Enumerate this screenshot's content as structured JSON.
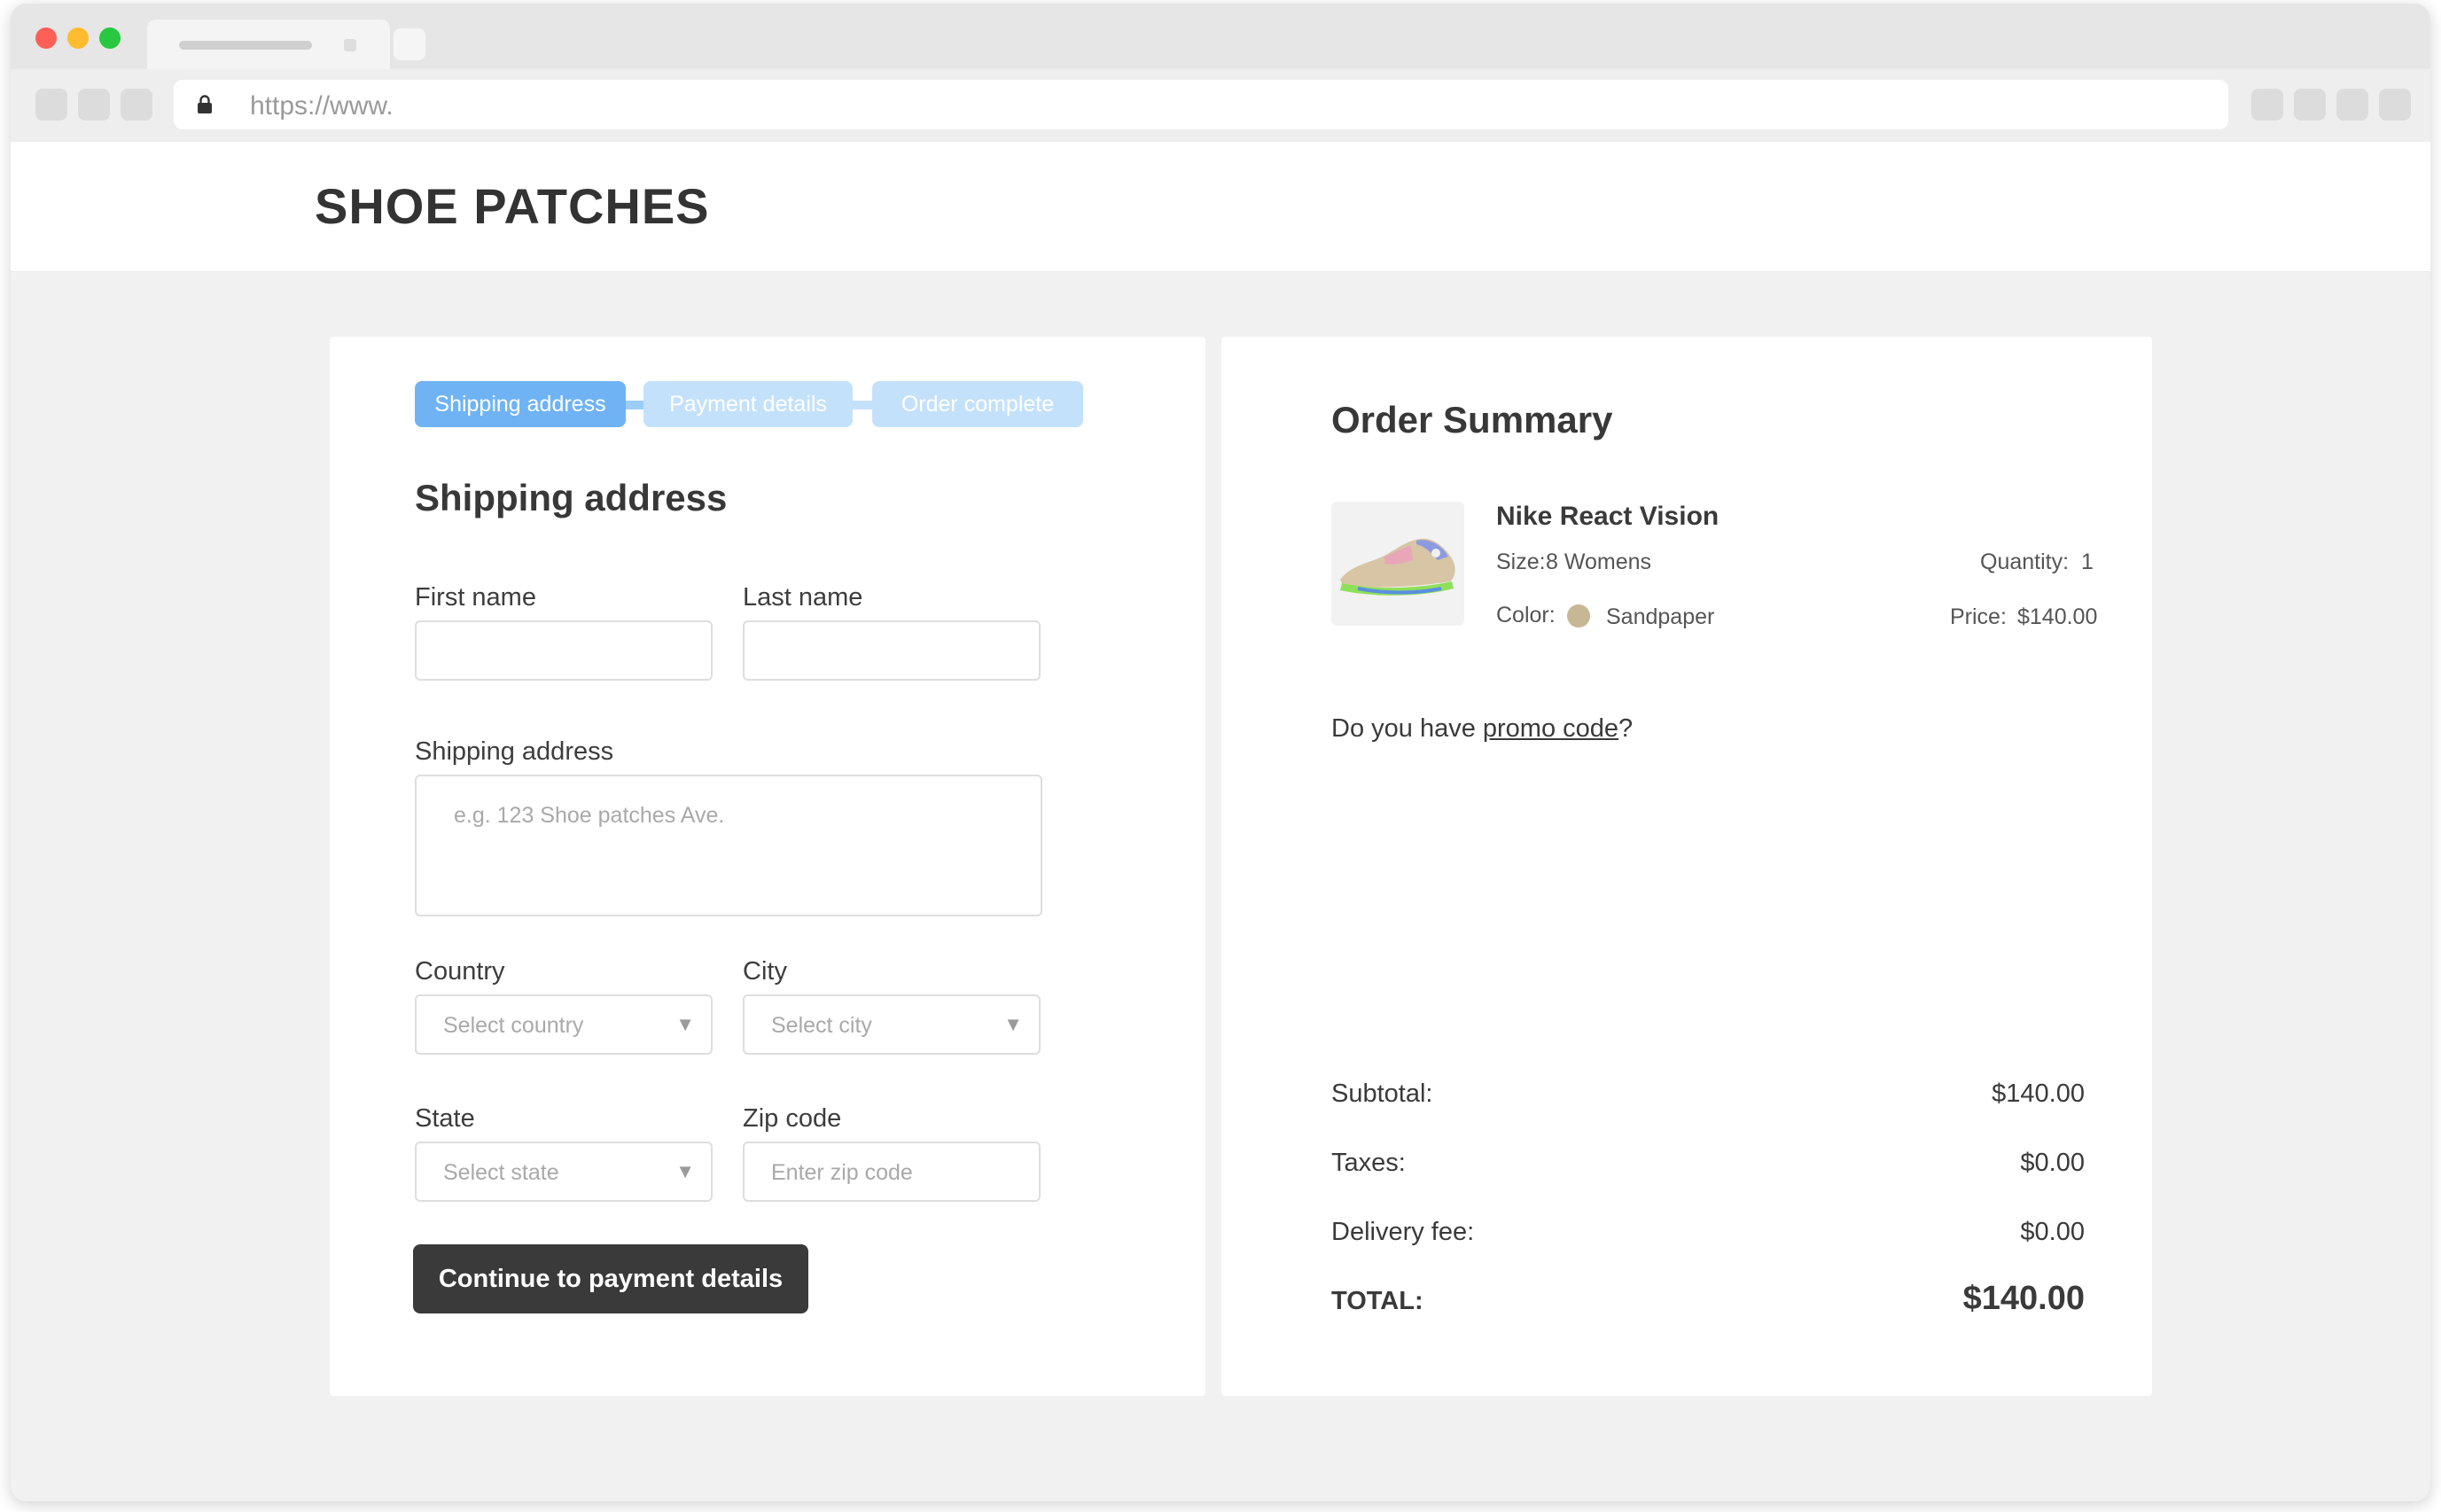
{
  "browser": {
    "url": "https://www.",
    "icons": [
      "lock-icon"
    ]
  },
  "site": {
    "logo": "SHOE PATCHES"
  },
  "steps": [
    {
      "label": "Shipping address",
      "state": "active"
    },
    {
      "label": "Payment details",
      "state": "inactive"
    },
    {
      "label": "Order complete",
      "state": "inactive"
    }
  ],
  "form": {
    "title": "Shipping address",
    "first_name": {
      "label": "First name",
      "value": ""
    },
    "last_name": {
      "label": "Last name",
      "value": ""
    },
    "address": {
      "label": "Shipping address",
      "placeholder": "e.g. 123 Shoe patches Ave."
    },
    "country": {
      "label": "Country",
      "placeholder": "Select country"
    },
    "city": {
      "label": "City",
      "placeholder": "Select city"
    },
    "state": {
      "label": "State",
      "placeholder": "Select state"
    },
    "zip": {
      "label": "Zip code",
      "placeholder": "Enter zip code"
    },
    "submit": "Continue to payment details"
  },
  "summary": {
    "title": "Order Summary",
    "product": {
      "name": "Nike React Vision",
      "size_label": "Size:",
      "size": "8 Womens",
      "color_label": "Color:",
      "color": "Sandpaper",
      "color_hex": "#c8b795",
      "quantity_label": "Quantity:",
      "quantity": "1",
      "price_label": "Price:",
      "price": "$140.00"
    },
    "promo": {
      "prefix": "Do you have ",
      "link": "promo code",
      "suffix": "?"
    },
    "subtotal": {
      "label": "Subtotal:",
      "value": "$140.00"
    },
    "taxes": {
      "label": "Taxes:",
      "value": "$0.00"
    },
    "delivery": {
      "label": "Delivery fee:",
      "value": "$0.00"
    },
    "total": {
      "label": "TOTAL:",
      "value": "$140.00"
    }
  },
  "colors": {
    "step_active": "#6fb3f5",
    "step_inactive": "#c4e1fb",
    "button_bg": "#3a3a3a",
    "page_bg": "#f1f1f1"
  }
}
